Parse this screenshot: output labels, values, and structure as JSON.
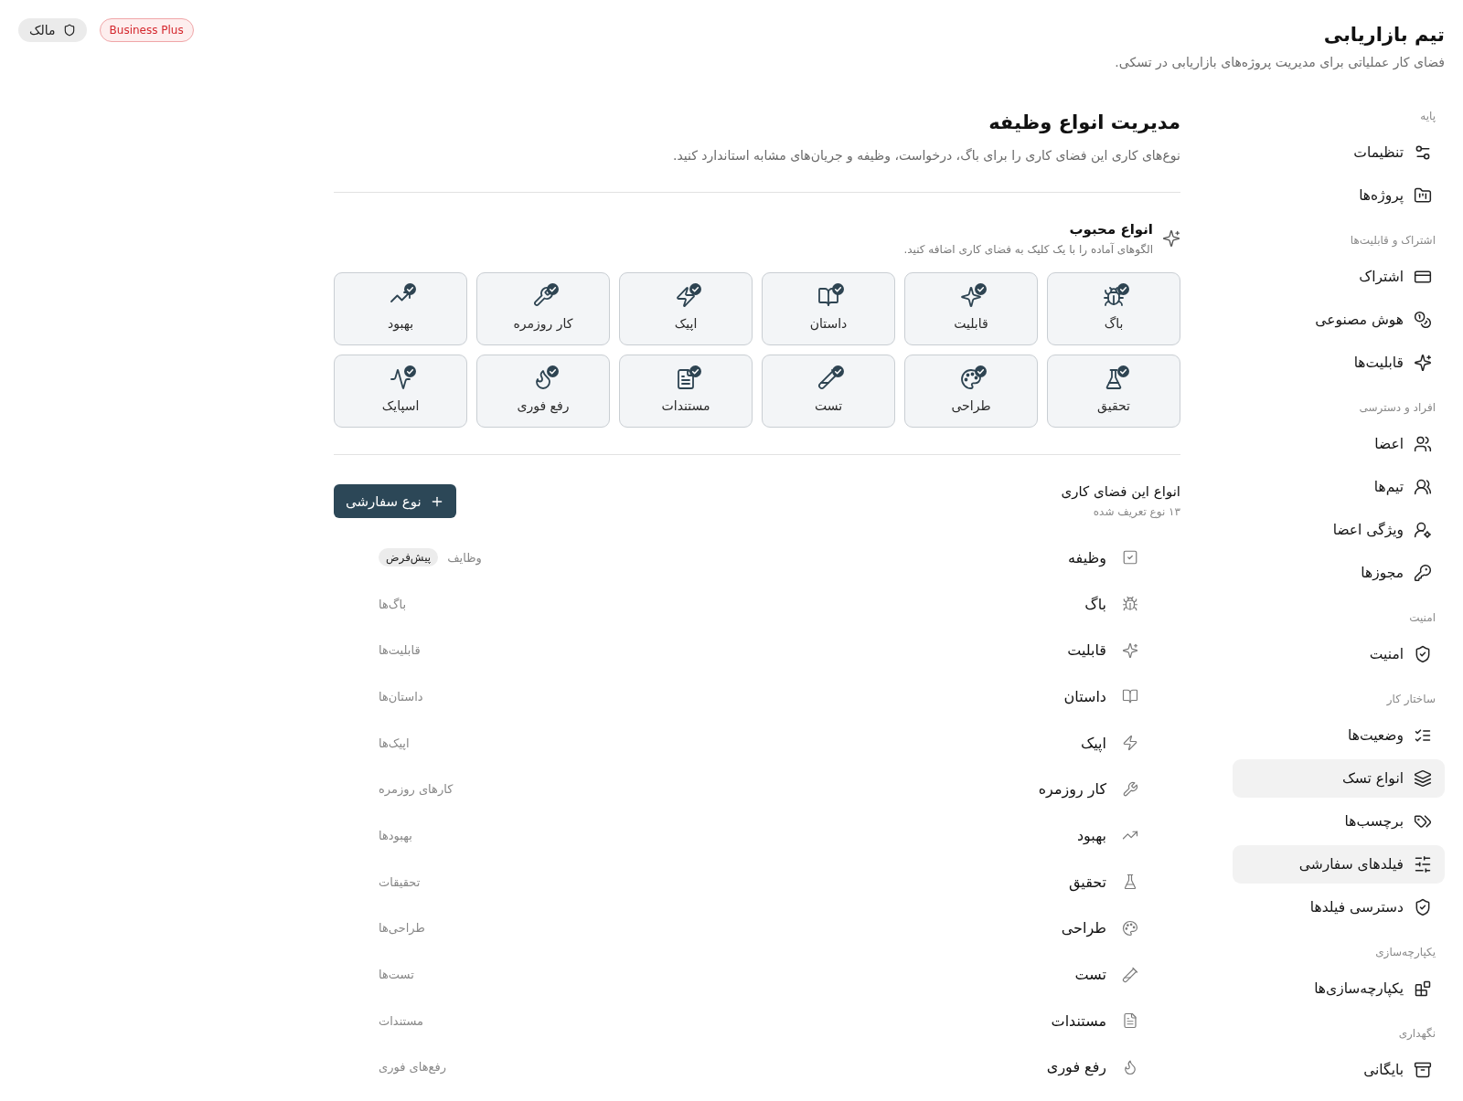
{
  "header": {
    "title": "تیم بازاریابی",
    "subtitle": "فضای کار عملیاتی برای مدیریت پروژه‌های بازاریابی در تسکی.",
    "plan_badge": "Business Plus",
    "role_badge": "مالک"
  },
  "sidebar": {
    "sections": [
      {
        "label": "پایه",
        "items": [
          {
            "label": "تنظیمات",
            "kind": "settings",
            "selected": false
          },
          {
            "label": "پروژه‌ها",
            "kind": "projects",
            "selected": false
          }
        ]
      },
      {
        "label": "اشتراک و قابلیت‌ها",
        "items": [
          {
            "label": "اشتراک",
            "kind": "subscription",
            "selected": false
          },
          {
            "label": "هوش مصنوعی",
            "kind": "ai",
            "selected": false
          },
          {
            "label": "قابلیت‌ها",
            "kind": "capabilities",
            "selected": false
          }
        ]
      },
      {
        "label": "افراد و دسترسی",
        "items": [
          {
            "label": "اعضا",
            "kind": "members",
            "selected": false
          },
          {
            "label": "تیم‌ها",
            "kind": "teams",
            "selected": false
          },
          {
            "label": "ویژگی اعضا",
            "kind": "attributes",
            "selected": false
          },
          {
            "label": "مجوزها",
            "kind": "permissions",
            "selected": false
          }
        ]
      },
      {
        "label": "امنیت",
        "items": [
          {
            "label": "امنیت",
            "kind": "security",
            "selected": false
          }
        ]
      },
      {
        "label": "ساختار کار",
        "items": [
          {
            "label": "وضعیت‌ها",
            "kind": "statuses",
            "selected": false
          },
          {
            "label": "انواع تسک",
            "kind": "types",
            "selected": true
          },
          {
            "label": "برچسب‌ها",
            "kind": "labels",
            "selected": false
          },
          {
            "label": "فیلدهای سفارشی",
            "kind": "fields",
            "selected": true
          },
          {
            "label": "دسترسی فیلدها",
            "kind": "access",
            "selected": false
          }
        ]
      },
      {
        "label": "یکپارچه‌سازی",
        "items": [
          {
            "label": "یکپارچه‌سازی‌ها",
            "kind": "integrations",
            "selected": false
          }
        ]
      },
      {
        "label": "نگهداری",
        "items": [
          {
            "label": "بایگانی",
            "kind": "archive",
            "selected": false
          }
        ]
      }
    ]
  },
  "page": {
    "title": "مدیریت انواع وظیفه",
    "description": "نوع‌های کاری این فضای کاری را برای باگ، درخواست، وظیفه و جریان‌های مشابه استاندارد کنید."
  },
  "popular_types": {
    "title": "انواع محبوب",
    "subtitle": "الگوهای آماده را با یک کلیک به فضای کاری اضافه کنید.",
    "items": [
      {
        "label": "باگ",
        "kind": "bug",
        "added": true
      },
      {
        "label": "قابلیت",
        "kind": "feature",
        "added": true
      },
      {
        "label": "داستان",
        "kind": "story",
        "added": true
      },
      {
        "label": "اپیک",
        "kind": "epic",
        "added": true
      },
      {
        "label": "کار روزمره",
        "kind": "chore",
        "added": true
      },
      {
        "label": "بهبود",
        "kind": "improvement",
        "added": true
      },
      {
        "label": "تحقیق",
        "kind": "research",
        "added": true
      },
      {
        "label": "طراحی",
        "kind": "design",
        "added": true
      },
      {
        "label": "تست",
        "kind": "test",
        "added": true
      },
      {
        "label": "مستندات",
        "kind": "docs",
        "added": true
      },
      {
        "label": "رفع فوری",
        "kind": "hotfix",
        "added": true
      },
      {
        "label": "اسپایک",
        "kind": "spike",
        "added": true
      }
    ]
  },
  "workspace_types": {
    "title": "انواع این فضای کاری",
    "count": "۱۳ نوع تعریف شده",
    "add_button": "نوع سفارشی",
    "default_label": "پیش‌فرض",
    "rows": [
      {
        "name": "وظیفه",
        "plural": "وظایف",
        "kind": "task",
        "default": true
      },
      {
        "name": "باگ",
        "plural": "باگ‌ها",
        "kind": "bug",
        "default": false
      },
      {
        "name": "قابلیت",
        "plural": "قابلیت‌ها",
        "kind": "feature",
        "default": false
      },
      {
        "name": "داستان",
        "plural": "داستان‌ها",
        "kind": "story",
        "default": false
      },
      {
        "name": "اپیک",
        "plural": "اپیک‌ها",
        "kind": "epic",
        "default": false
      },
      {
        "name": "کار روزمره",
        "plural": "کارهای روزمره",
        "kind": "chore",
        "default": false
      },
      {
        "name": "بهبود",
        "plural": "بهبودها",
        "kind": "improvement",
        "default": false
      },
      {
        "name": "تحقیق",
        "plural": "تحقیقات",
        "kind": "research",
        "default": false
      },
      {
        "name": "طراحی",
        "plural": "طراحی‌ها",
        "kind": "design",
        "default": false
      },
      {
        "name": "تست",
        "plural": "تست‌ها",
        "kind": "test",
        "default": false
      },
      {
        "name": "مستندات",
        "plural": "مستندات",
        "kind": "docs",
        "default": false
      },
      {
        "name": "رفع فوری",
        "plural": "رفع‌های فوری",
        "kind": "hotfix",
        "default": false
      }
    ]
  }
}
